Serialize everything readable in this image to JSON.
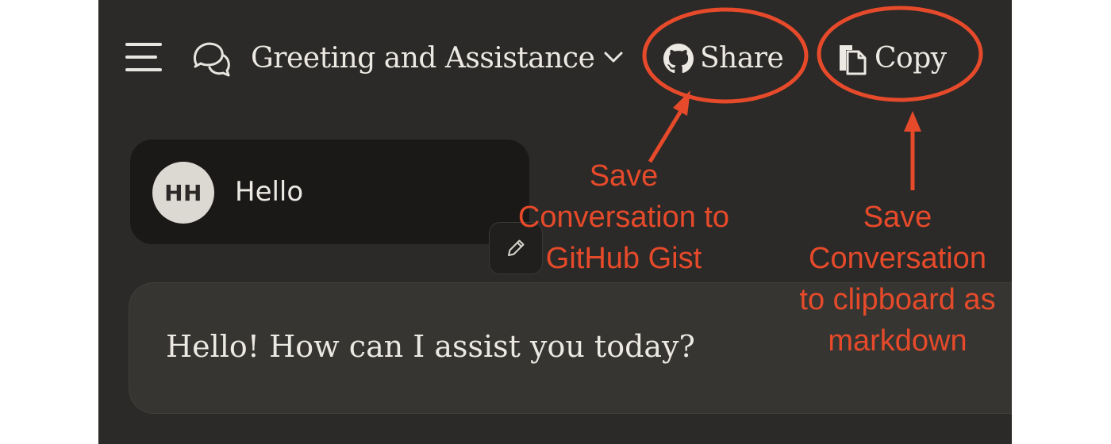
{
  "header": {
    "conversation_title": "Greeting and Assistance",
    "share_label": "Share",
    "copy_label": "Copy"
  },
  "messages": [
    {
      "role": "user",
      "avatar_initials": "HH",
      "text": "Hello"
    },
    {
      "role": "assistant",
      "text": "Hello! How can I assist you today?"
    }
  ],
  "annotations": {
    "share": [
      "Save",
      "Conversation to",
      "GitHub Gist"
    ],
    "copy": [
      "Save",
      "Conversation",
      "to clipboard as",
      "markdown"
    ]
  },
  "colors": {
    "background": "#2b2a28",
    "text": "#ece9e3",
    "annotation": "#e64a2a",
    "user_bubble": "#1a1917",
    "assistant_bubble": "#363532"
  }
}
